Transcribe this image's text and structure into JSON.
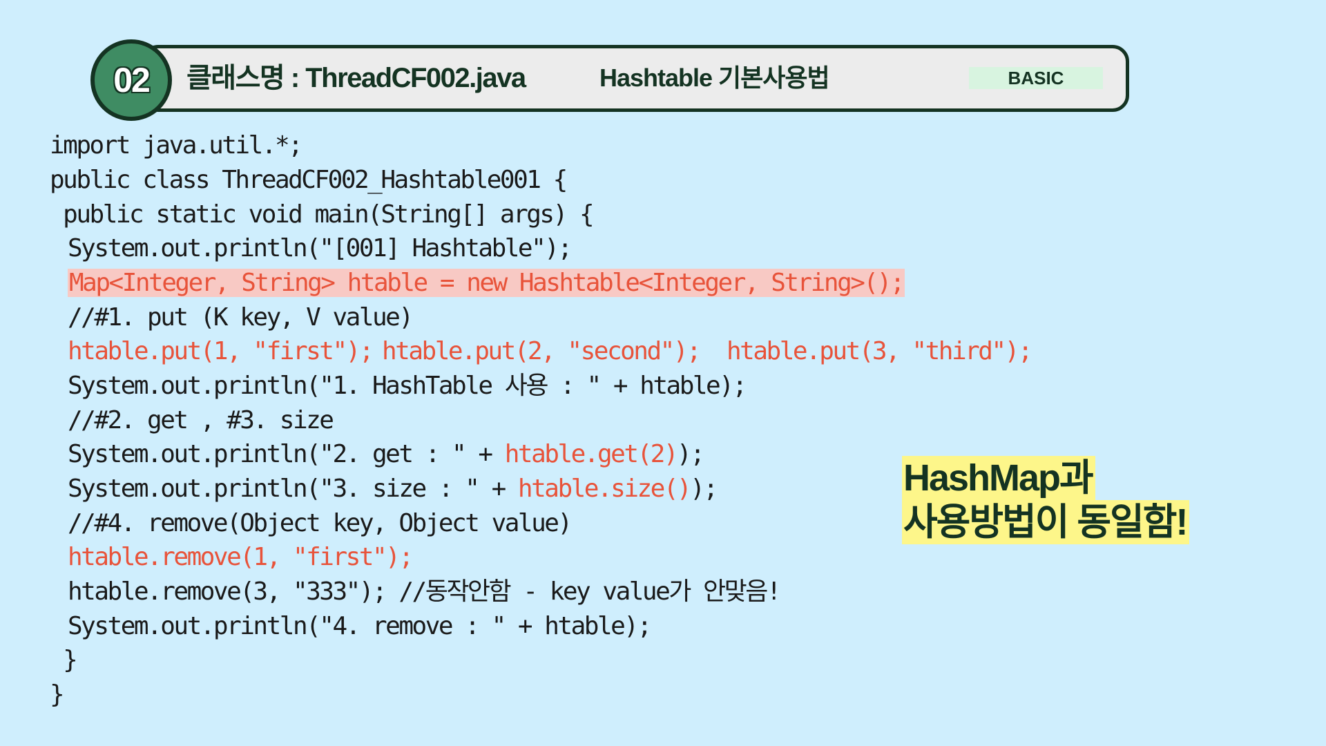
{
  "header": {
    "number": "02",
    "class_name": "클래스명 : ThreadCF002.java",
    "topic": "Hashtable 기본사용법",
    "level": "BASIC"
  },
  "code": {
    "l1": "import java.util.*;",
    "l2": "public class ThreadCF002_Hashtable001 {",
    "l3": " public static void main(String[] args) {",
    "l4": "System.out.println(\"[001] Hashtable\");",
    "l5": "Map<Integer, String> htable = new Hashtable<Integer, String>();",
    "l6": "//#1. put (K key, V value)",
    "l7a": "htable.put(1, \"first\");",
    "l7b": "htable.put(2, \"second\");",
    "l7c": "htable.put(3, \"third\");",
    "l8": "System.out.println(\"1. HashTable 사용 : \" + htable);",
    "l9": "//#2. get , #3. size",
    "l10a": "System.out.println(\"2. get : \" + ",
    "l10b": "htable.get(2)",
    "l10c": ");",
    "l11a": "System.out.println(\"3. size : \" + ",
    "l11b": "htable.size()",
    "l11c": ");",
    "l12": "//#4. remove(Object key, Object value)",
    "l13": "htable.remove(1, \"first\");",
    "l14": "htable.remove(3, \"333\"); //동작안함 - key value가 안맞음!",
    "l15": "System.out.println(\"4. remove : \" + htable);",
    "l16": " }",
    "l17": "}"
  },
  "note": {
    "line1": "HashMap과",
    "line2": "사용방법이 동일함!"
  },
  "colors": {
    "background": "#cfeefd",
    "dark_green": "#143322",
    "badge_green": "#3f8c63",
    "highlight_red": "#e8533a",
    "highlight_bg": "#f8c9c4",
    "note_yellow": "#fdf68a"
  }
}
